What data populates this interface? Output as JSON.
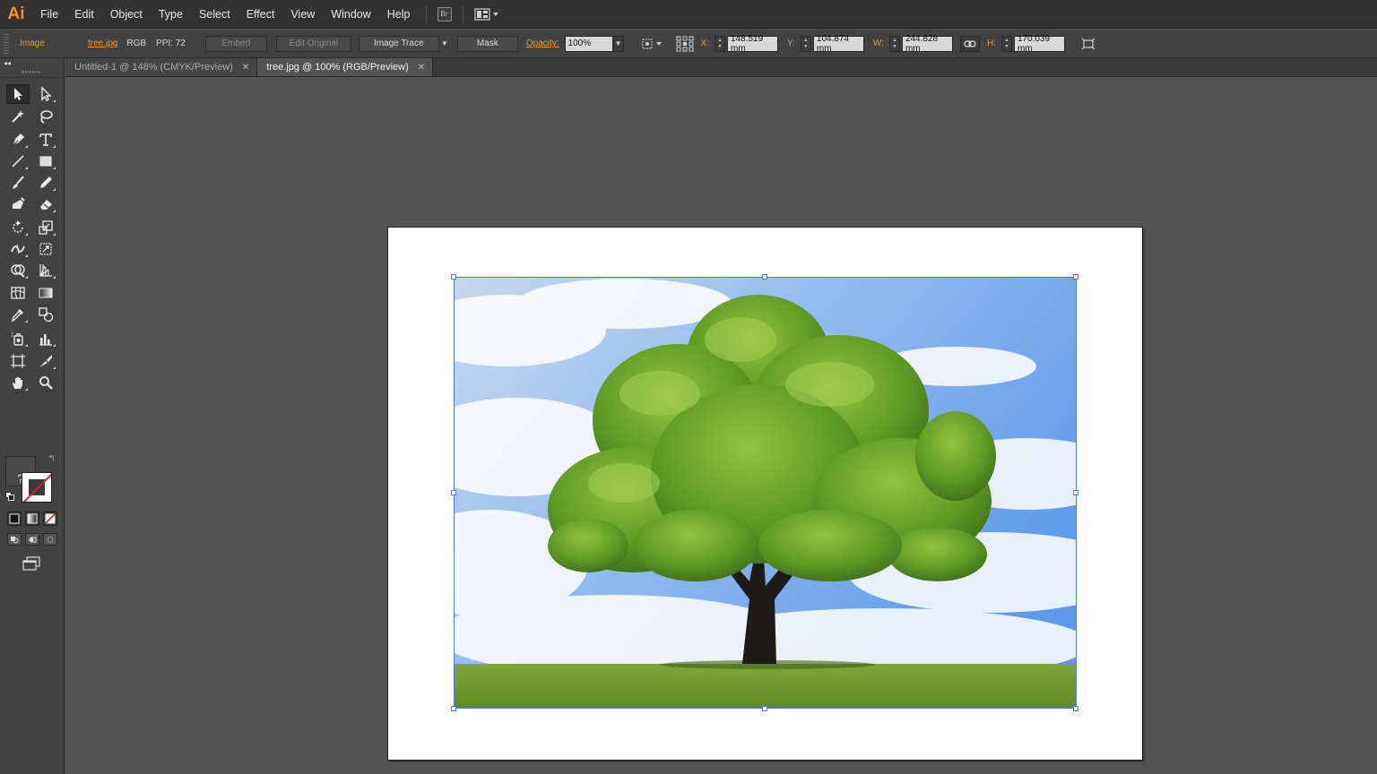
{
  "app": {
    "logo": "Ai",
    "logo_color": "#f7931e"
  },
  "menu": {
    "items": [
      "File",
      "Edit",
      "Object",
      "Type",
      "Select",
      "Effect",
      "View",
      "Window",
      "Help"
    ],
    "bridge_icon_label": "Br"
  },
  "control_bar": {
    "object_type": "Image",
    "filename": "tree.jpg",
    "color_mode": "RGB",
    "ppi": "PPI: 72",
    "embed_label": "Embed",
    "edit_original_label": "Edit Original",
    "image_trace_label": "Image Trace",
    "mask_label": "Mask",
    "opacity_label": "Opacity:",
    "opacity_value": "100%",
    "x_label": "X:",
    "x_value": "148.519 mm",
    "y_label": "Y:",
    "y_value": "104.874 mm",
    "w_label": "W:",
    "w_value": "244.828 mm",
    "h_label": "H:",
    "h_value": "170.039 mm"
  },
  "tabs": [
    {
      "label": "Untitled-1 @ 148% (CMYK/Preview)",
      "active": false
    },
    {
      "label": "tree.jpg @ 100% (RGB/Preview)",
      "active": true
    }
  ],
  "toolbar": {
    "fill_unknown_glyph": "?"
  },
  "colors": {
    "selection": "#4f7ad6",
    "accent": "#e89a34",
    "stroke_none": "#d0202a"
  }
}
